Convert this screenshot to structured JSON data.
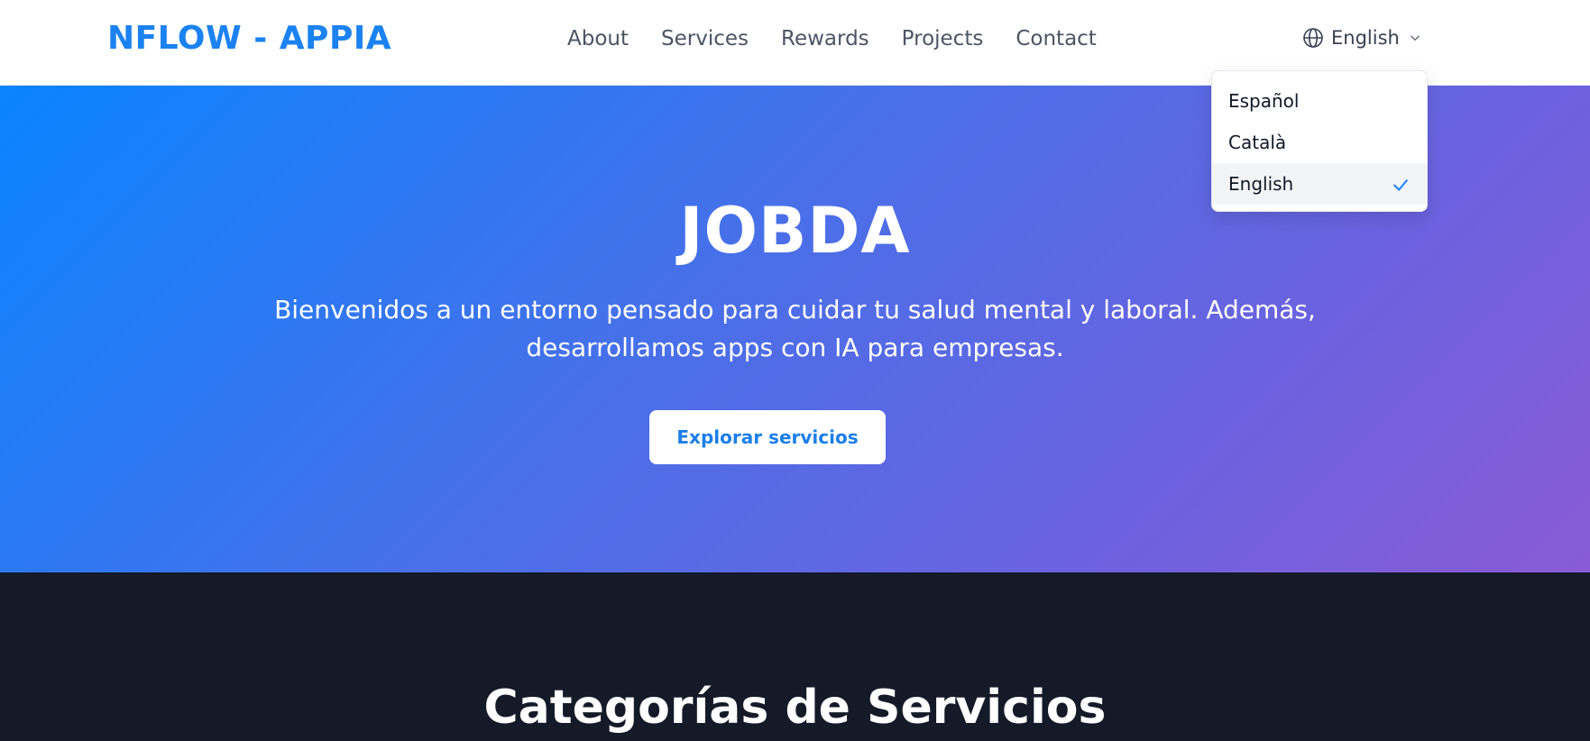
{
  "nav": {
    "brand": "NFLOW - APPIA",
    "links": [
      "About",
      "Services",
      "Rewards",
      "Projects",
      "Contact"
    ]
  },
  "language": {
    "current": "English",
    "options": [
      "Español",
      "Català",
      "English"
    ],
    "selected": "English",
    "icons": {
      "globe": "globe-icon",
      "chevron": "chevron-down-icon",
      "check": "check-icon"
    }
  },
  "hero": {
    "title": "JOBDA",
    "subtitle": "Bienvenidos a un entorno pensado para cuidar tu salud mental y laboral. Además, desarrollamos apps con IA para empresas.",
    "cta": "Explorar servicios"
  },
  "categories": {
    "title": "Categorías de Servicios"
  },
  "colors": {
    "brand": "#1b82f0",
    "hero_gradient_start": "#0a84ff",
    "hero_gradient_end": "#8a5bd6",
    "dark_bg": "#141a28",
    "check": "#1b82f0"
  }
}
